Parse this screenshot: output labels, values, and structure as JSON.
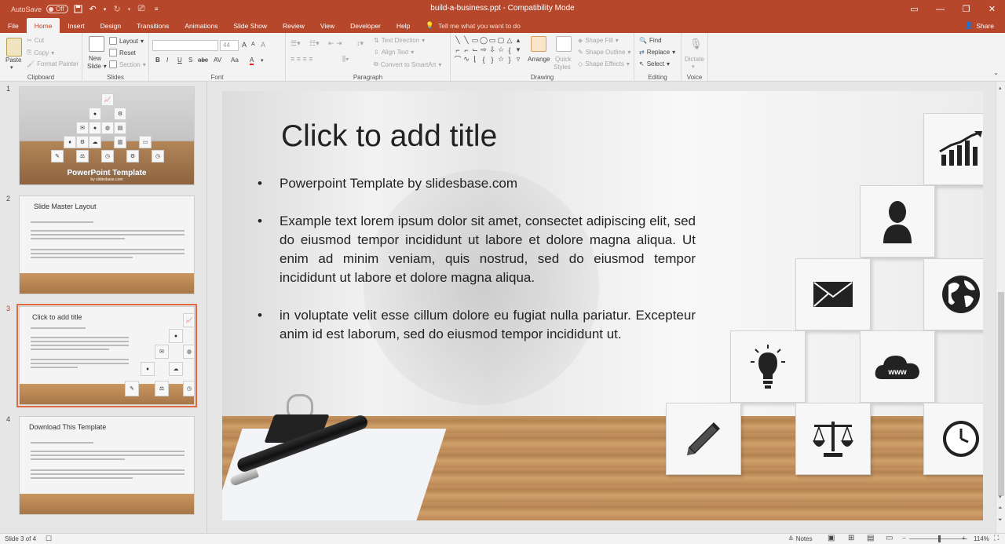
{
  "titlebar": {
    "autosave_label": "AutoSave",
    "autosave_state": "Off",
    "document_title": "build-a-business.ppt  -  Compatibility Mode"
  },
  "tabs": [
    "File",
    "Home",
    "Insert",
    "Design",
    "Transitions",
    "Animations",
    "Slide Show",
    "Review",
    "View",
    "Developer",
    "Help"
  ],
  "active_tab": "Home",
  "tellme": "Tell me what you want to do",
  "share": "Share",
  "ribbon": {
    "clipboard": {
      "paste": "Paste",
      "cut": "Cut",
      "copy": "Copy",
      "format_painter": "Format Painter",
      "label": "Clipboard"
    },
    "slides": {
      "new_slide": "New",
      "new_slide2": "Slide",
      "layout": "Layout",
      "reset": "Reset",
      "section": "Section",
      "label": "Slides"
    },
    "font": {
      "font_size": "44",
      "label": "Font",
      "bold": "B",
      "italic": "I",
      "underline": "U",
      "strike": "S",
      "shadow": "abc",
      "spacing": "AV",
      "case": "Aa",
      "grow": "A",
      "shrink": "A",
      "clear": "A",
      "color": "A"
    },
    "paragraph": {
      "text_direction": "Text Direction",
      "align_text": "Align Text",
      "convert": "Convert to SmartArt",
      "label": "Paragraph"
    },
    "drawing": {
      "arrange": "Arrange",
      "quick_styles": "Quick",
      "quick_styles2": "Styles",
      "shape_fill": "Shape Fill",
      "shape_outline": "Shape Outline",
      "shape_effects": "Shape Effects",
      "label": "Drawing"
    },
    "editing": {
      "find": "Find",
      "replace": "Replace",
      "select": "Select",
      "label": "Editing"
    },
    "voice": {
      "dictate": "Dictate",
      "label": "Voice"
    }
  },
  "thumbnails": [
    {
      "num": "1",
      "title": "PowerPoint Template",
      "subtitle": "by slidesbase.com"
    },
    {
      "num": "2",
      "title": "Slide Master Layout"
    },
    {
      "num": "3",
      "title": "Click to add title"
    },
    {
      "num": "4",
      "title": "Download This Template"
    }
  ],
  "selected_slide": "3",
  "slide": {
    "title": "Click to add title",
    "bullets": [
      "Powerpoint Template by slidesbase.com",
      "Example text lorem ipsum dolor sit amet, consectet adipiscing elit, sed do eiusmod tempor incididunt ut labore et dolore magna aliqua. Ut enim ad minim veniam, quis nostrud, sed do eiusmod tempor incididunt ut labore et dolore magna aliqua.",
      "in voluptate velit esse cillum dolore eu fugiat nulla pariatur. Excepteur anim id est laborum, sed do eiusmod tempor incididunt ut."
    ],
    "cube_icons": [
      "chart-icon",
      "person-icon",
      "envelope-icon",
      "globe-icon",
      "lightbulb-icon",
      "cloud-www-icon",
      "pencil-icon",
      "scales-icon",
      "clock-icon"
    ],
    "cloud_text": "www"
  },
  "status": {
    "slide_info": "Slide 3 of 4",
    "notes": "Notes",
    "zoom": "114%"
  },
  "colors": {
    "accent": "#b7472a",
    "selection": "#e0693f"
  }
}
